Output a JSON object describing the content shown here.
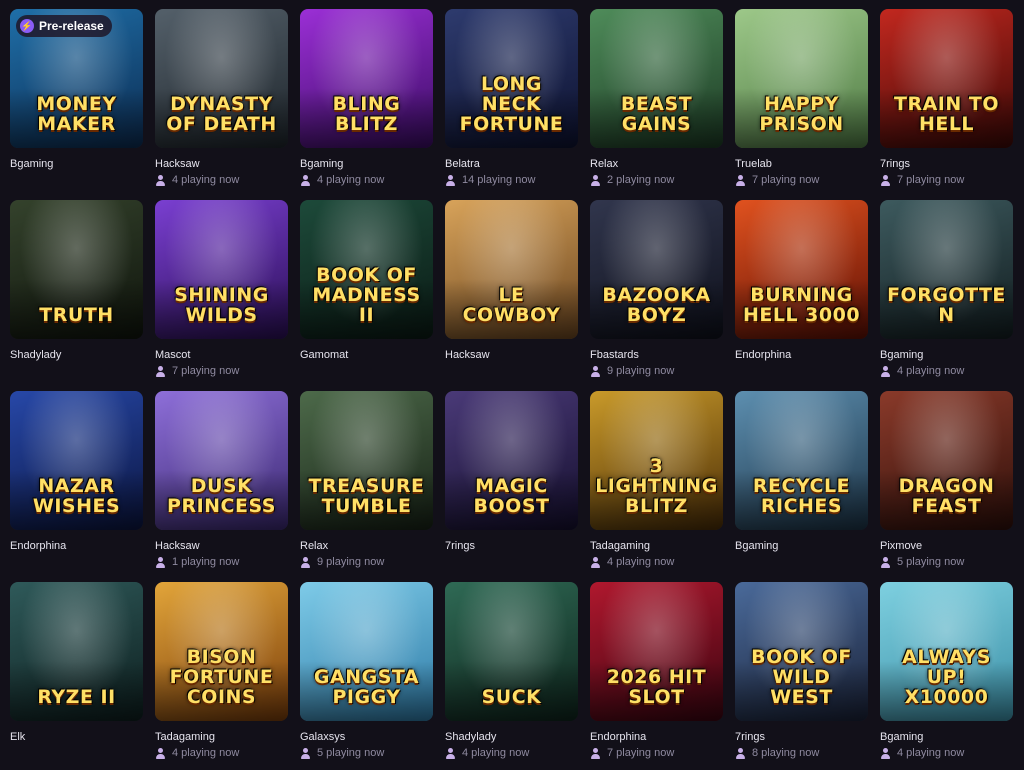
{
  "badge_label": "Pre-release",
  "colors": {
    "background": "#121019",
    "provider_text": "#e6e4ee",
    "players_text": "#8f8aa0",
    "badge_accent": "#8a5cf6"
  },
  "games": [
    {
      "title": "Money Maker",
      "provider": "Bgaming",
      "players": "",
      "colors": [
        "#1f6fa8",
        "#0c2c52"
      ],
      "badge": true
    },
    {
      "title": "Dynasty of Death",
      "provider": "Hacksaw",
      "players": "4 playing now",
      "colors": [
        "#54606a",
        "#1e252b"
      ]
    },
    {
      "title": "Bling Blitz",
      "provider": "Bgaming",
      "players": "4 playing now",
      "colors": [
        "#9b2fd6",
        "#3a0c63"
      ]
    },
    {
      "title": "Long Neck Fortune",
      "provider": "Belatra",
      "players": "14 playing now",
      "colors": [
        "#2e3b6e",
        "#0d1230"
      ]
    },
    {
      "title": "Beast Gains",
      "provider": "Relax",
      "players": "2 playing now",
      "colors": [
        "#4f8c5a",
        "#1c3a24"
      ]
    },
    {
      "title": "Happy Prison",
      "provider": "Truelab",
      "players": "7 playing now",
      "colors": [
        "#9dc889",
        "#4f7a44"
      ]
    },
    {
      "title": "Train to Hell",
      "provider": "7rings",
      "players": "7 playing now",
      "colors": [
        "#c2281f",
        "#3b0806"
      ]
    },
    {
      "title": "Truth",
      "provider": "Shadylady",
      "players": "",
      "colors": [
        "#34422c",
        "#0f140c"
      ]
    },
    {
      "title": "Shining Wilds",
      "provider": "Mascot",
      "players": "7 playing now",
      "colors": [
        "#7a3fd1",
        "#2a0f55"
      ]
    },
    {
      "title": "Book of Madness II",
      "provider": "Gamomat",
      "players": "",
      "colors": [
        "#1d4a3a",
        "#0a1a14"
      ]
    },
    {
      "title": "Le Cowboy",
      "provider": "Hacksaw",
      "players": "",
      "colors": [
        "#d8a35a",
        "#6a4520"
      ]
    },
    {
      "title": "Bazooka Boyz",
      "provider": "Fbastards",
      "players": "9 playing now",
      "colors": [
        "#31364d",
        "#0e101b"
      ]
    },
    {
      "title": "Burning Hell 3000",
      "provider": "Endorphina",
      "players": "",
      "colors": [
        "#e0521f",
        "#5e0f04"
      ]
    },
    {
      "title": "Forgotten",
      "provider": "Bgaming",
      "players": "4 playing now",
      "colors": [
        "#3d5a5e",
        "#121d20"
      ]
    },
    {
      "title": "Nazar Wishes",
      "provider": "Endorphina",
      "players": "",
      "colors": [
        "#2748a8",
        "#0b1540"
      ]
    },
    {
      "title": "Dusk Princess",
      "provider": "Hacksaw",
      "players": "1 playing now",
      "colors": [
        "#8e6fd9",
        "#3a2870"
      ]
    },
    {
      "title": "Treasure Tumble",
      "provider": "Relax",
      "players": "9 playing now",
      "colors": [
        "#4d6a4a",
        "#172216"
      ]
    },
    {
      "title": "Magic Boost",
      "provider": "7rings",
      "players": "",
      "colors": [
        "#4a3a78",
        "#150f2e"
      ]
    },
    {
      "title": "3 Lightning Blitz",
      "provider": "Tadagaming",
      "players": "4 playing now",
      "colors": [
        "#c99a2a",
        "#4a2d07"
      ]
    },
    {
      "title": "Recycle Riches",
      "provider": "Bgaming",
      "players": "",
      "colors": [
        "#5d8fb0",
        "#1c3346"
      ]
    },
    {
      "title": "Dragon Feast",
      "provider": "Pixmove",
      "players": "5 playing now",
      "colors": [
        "#8a3a2a",
        "#2e0f0a"
      ]
    },
    {
      "title": "Ryze II",
      "provider": "Elk",
      "players": "",
      "colors": [
        "#2f5a5a",
        "#0d1e1e"
      ]
    },
    {
      "title": "Bison Fortune Coins",
      "provider": "Tadagaming",
      "players": "4 playing now",
      "colors": [
        "#e2a53a",
        "#7a3d0b"
      ]
    },
    {
      "title": "Gangsta Piggy",
      "provider": "Galaxsys",
      "players": "5 playing now",
      "colors": [
        "#7ecbe8",
        "#2e7aa6"
      ]
    },
    {
      "title": "Suck",
      "provider": "Shadylady",
      "players": "4 playing now",
      "colors": [
        "#2f6a55",
        "#0e241c"
      ]
    },
    {
      "title": "2026 Hit Slot",
      "provider": "Endorphina",
      "players": "7 playing now",
      "colors": [
        "#b0182e",
        "#3a0410"
      ]
    },
    {
      "title": "Book of Wild West",
      "provider": "7rings",
      "players": "8 playing now",
      "colors": [
        "#4a6a9a",
        "#1a2238"
      ]
    },
    {
      "title": "Always Up! x10000",
      "provider": "Bgaming",
      "players": "4 playing now",
      "colors": [
        "#7ed0e0",
        "#3c8fa6"
      ]
    }
  ]
}
